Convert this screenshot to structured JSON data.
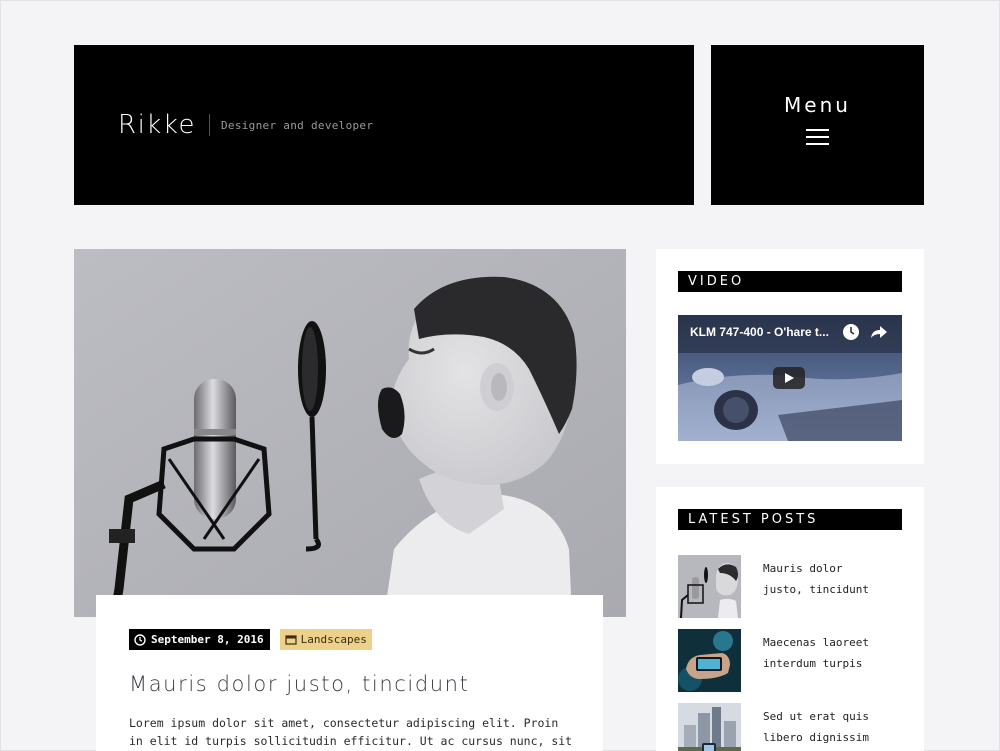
{
  "header": {
    "site_title": "Rikke",
    "tagline": "Designer and developer",
    "menu_label": "Menu"
  },
  "post": {
    "date": "September 8, 2016",
    "category": "Landscapes",
    "title": "Mauris dolor justo, tincidunt",
    "excerpt": "Lorem ipsum dolor sit amet, consectetur adipiscing elit. Proin in elit id turpis sollicitudin efficitur. Ut ac cursus nunc, sit"
  },
  "sidebar": {
    "video_widget": {
      "title": "VIDEO",
      "video_title": "KLM 747-400 - O'hare t..."
    },
    "latest_posts_widget": {
      "title": "LATEST POSTS",
      "items": [
        {
          "title": "Mauris dolor justo, tincidunt"
        },
        {
          "title": "Maecenas laoreet interdum turpis"
        },
        {
          "title": "Sed ut erat quis libero dignissim"
        }
      ]
    }
  },
  "icons": {
    "clock": "clock-icon",
    "folder": "folder-icon",
    "menu": "hamburger-menu-icon",
    "play": "play-icon",
    "watch_later": "watch-later-icon",
    "share": "share-icon"
  },
  "colors": {
    "background": "#f4f4f6",
    "header_bg": "#000000",
    "category_badge": "#edd08a",
    "title_text": "#3b3b44"
  }
}
